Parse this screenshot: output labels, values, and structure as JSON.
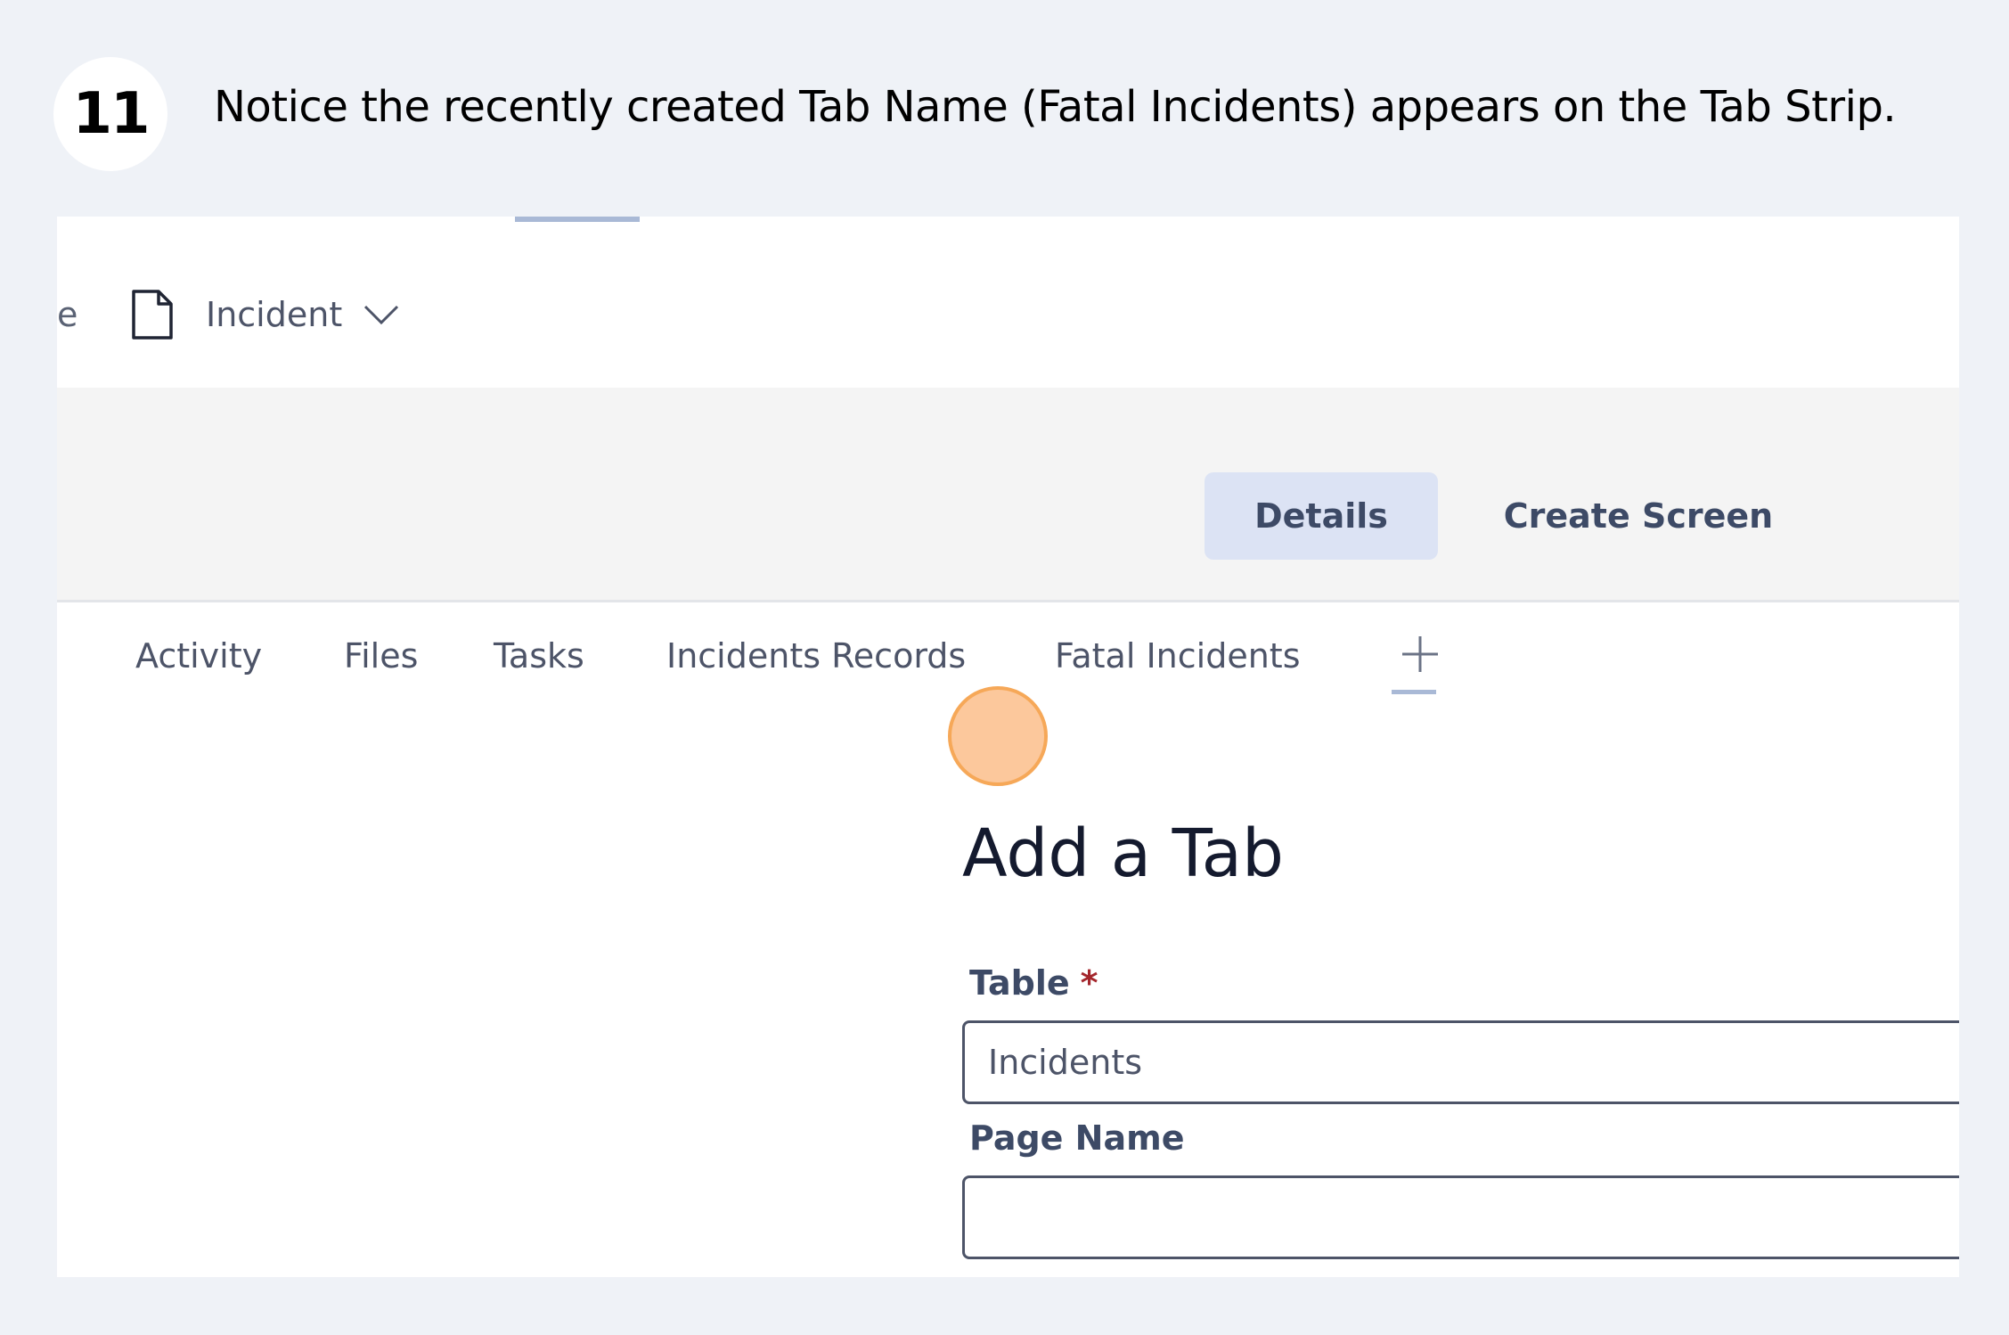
{
  "step": {
    "number": "11",
    "instruction": "Notice the recently created Tab Name (Fatal Incidents) appears on the Tab Strip."
  },
  "breadcrumb": {
    "fragment": "e",
    "label": "Incident",
    "icon": "document-icon",
    "dropdown_icon": "chevron-down-icon"
  },
  "toolbar": {
    "details_label": "Details",
    "create_screen_label": "Create Screen"
  },
  "tabs": [
    {
      "label": "Activity"
    },
    {
      "label": "Files"
    },
    {
      "label": "Tasks"
    },
    {
      "label": "Incidents Records"
    },
    {
      "label": "Fatal Incidents"
    }
  ],
  "add_tab_icon": "plus-icon",
  "form": {
    "title": "Add a Tab",
    "table_label": "Table",
    "required_mark": "*",
    "table_value": "Incidents",
    "page_name_label": "Page Name",
    "page_name_value": ""
  },
  "colors": {
    "click_marker": "#fcc89c",
    "accent": "#dce3f4",
    "required": "#a4262c"
  }
}
